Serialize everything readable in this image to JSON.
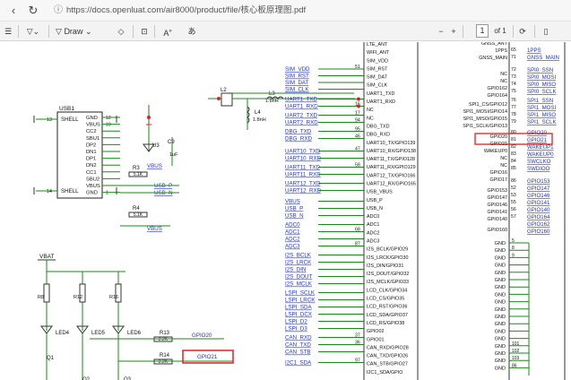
{
  "browser": {
    "url": "https://docs.openluat.com/air8000/product/file/核心板原理图.pdf",
    "refresh_icon": "refresh-icon",
    "info_icon": "info-icon"
  },
  "pdf_toolbar": {
    "draw_label": "Draw",
    "page_current": "1",
    "page_total": "of 1",
    "icons": [
      "contents-icon",
      "filter-icon",
      "draw-icon",
      "eraser-icon",
      "text-icon",
      "read-aloud-icon",
      "translate-icon",
      "zoom-out-icon",
      "zoom-in-icon",
      "fit-icon",
      "rotate-icon",
      "book-icon"
    ]
  },
  "schematic": {
    "usb": {
      "title": "USB1",
      "left_pins": [
        "SHELL",
        "SHELL"
      ],
      "right_pins": [
        "GND",
        "VBUS",
        "CC2",
        "SBU1",
        "DP2",
        "DN1",
        "DP1",
        "DN2",
        "CC1",
        "SBU2",
        "VBUS",
        "GND"
      ],
      "right_nums": [
        "12",
        "10",
        "",
        "",
        "",
        "",
        "",
        "",
        "",
        "",
        "",
        "1"
      ],
      "left_nums": [
        "13",
        "14"
      ]
    },
    "top_parts": [
      "L2",
      "L3",
      "L4",
      "1.8nH",
      "1.8nH",
      "U3",
      "C9",
      "1uF"
    ],
    "resistors": [
      "R3",
      "5.1K",
      "R4",
      "5.1K",
      "R13",
      "2.2K",
      "R14",
      "2.2K",
      "R8",
      "R12",
      "R16"
    ],
    "nets_left": [
      "VBUS",
      "USB_P",
      "USB_N",
      "VBUS",
      "VBAT",
      "GPIO20",
      "GPIO21"
    ],
    "leds": [
      "LED4",
      "LED5",
      "LED6"
    ],
    "transistors": [
      "Q1",
      "Q2",
      "Q3"
    ],
    "net_labels_mid": [
      "SIM_VDD",
      "SIM_RST",
      "SIM_DAT",
      "SIM_CLK",
      "UART1_TXD",
      "UART1_RXD",
      "UART2_TXD",
      "UART2_RXD",
      "DBG_TXD",
      "DBG_RXD",
      "UART10_TXD",
      "UART10_RXD",
      "UART11_TXD",
      "UART11_RXD",
      "UART12_TXD",
      "UART12_RXD",
      "VBUS",
      "USB_P",
      "USB_N",
      "ADC0",
      "ADC1",
      "ADC2",
      "ADC3",
      "I2S_BCLK",
      "I2S_LRCK",
      "I2S_DIN",
      "I2S_DOUT",
      "I2S_MCLK",
      "LSPI_SCLK",
      "LSPI_LRCK",
      "LSPI_SDA",
      "LSPI_DCX",
      "LSPI_D2",
      "LSPI_D3",
      "CAN_RXD",
      "CAN_TXD",
      "CAN_STB",
      "I2C1_SDA"
    ],
    "pin_nums_mid": [
      "51",
      "",
      "",
      "",
      "",
      "16",
      "17",
      "94",
      "95",
      "46",
      "47",
      "",
      "58",
      "",
      "",
      "",
      "",
      "",
      "",
      "",
      "68",
      "",
      "87",
      "",
      "",
      "",
      "",
      "",
      "",
      "",
      "",
      "",
      "",
      "",
      "37",
      "36",
      "",
      "97"
    ],
    "signals_mid": [
      "LTE_ANT",
      "WIFI_ANT",
      "SIM_VDD",
      "SIM_RST",
      "SIM_DAT",
      "SIM_CLK",
      "UART1_TXD",
      "UART1_RXD",
      "NC",
      "NC",
      "DBG_TXD",
      "DBG_RXD",
      "UART10_TX/GPIO139",
      "UART10_RX/GPIO138",
      "UART11_TX/GPIO128",
      "UART11_RX/GPIO129",
      "UART12_TX/GPIO166",
      "UART12_RX/GPIO165",
      "USB_VBUS",
      "USB_P",
      "USB_N",
      "ADC0",
      "ADC1",
      "ADC2",
      "ADC3",
      "I2S_BCLK/GPIO29",
      "I2S_LRCK/GPIO30",
      "I2S_DIN/GPIO31",
      "I2S_DOUT/GPIO32",
      "I2S_MCLK/GPIO33",
      "LCD_CLK/GPIO34",
      "LCD_CS/GPIO35",
      "LCD_RST/GPIO36",
      "LCD_SDA/GPIO37",
      "LCD_RS/GPIO38",
      "GPIO02",
      "GPIO01",
      "CAN_RXD/GPIO28",
      "CAN_TXD/GPIO26",
      "CAN_STB/GPIO27",
      "I2C1_SDA/GPIO"
    ],
    "signals_right": [
      "GNSS_ANT",
      "1PPS",
      "GNSS_MAIN",
      "NC",
      "NC",
      "GPIO162",
      "GPIO164",
      "SPI1_CS/GPIO12",
      "SPI1_MOSI/GPIO14",
      "SPI1_MISO/GPIO15",
      "SPI1_SCLK/GPIO13",
      "GPIO20",
      "GPIO21",
      "WAKEUP0",
      "NC",
      "NC",
      "GPIO16",
      "GPIO17",
      "GPIO153",
      "GPIO147",
      "GPIO146",
      "GPIO141",
      "GPIO140",
      "GPIO160"
    ],
    "gnd_labels": [
      "GND",
      "GND",
      "GND",
      "GND",
      "GND",
      "GND",
      "GND",
      "GND",
      "GND",
      "GND",
      "GND",
      "GND",
      "GND",
      "GND",
      "GND",
      "GND",
      "GND",
      "GND"
    ],
    "gnd_nums": [
      "5",
      "8",
      "9",
      "",
      "",
      "",
      "",
      "",
      "",
      "",
      "",
      "",
      "",
      "",
      "101",
      "102",
      "103",
      "86"
    ],
    "pin_nums_right": [
      "65",
      "71",
      "72",
      "73",
      "74",
      "75",
      "76",
      "77",
      "78",
      "79",
      "80",
      "81",
      "82",
      "83",
      "84",
      "85",
      "86",
      "52",
      "53",
      "55",
      "56",
      "57"
    ],
    "net_labels_right": [
      "1PPS",
      "GNSS_MAIN",
      "SPI0_SSN",
      "SPI0_MOSI",
      "SPI0_MISO",
      "SPI0_SCLK",
      "SPI1_SSN",
      "SPI1_MOSI",
      "SPI1_MISO",
      "SPI1_SCLK",
      "GPIO20",
      "GPIO21",
      "WAKEUP1",
      "WAKEUP0",
      "SWCLKO",
      "SWDIOO",
      "GPIO153",
      "GPIO147",
      "GPIO146",
      "GPIO141",
      "GPIO140",
      "GPIO164",
      "GPIO162",
      "GPIO160"
    ],
    "highlight_color": "#e02020",
    "net_color": "#2233cc",
    "wire_color": "#1a8a1a"
  }
}
